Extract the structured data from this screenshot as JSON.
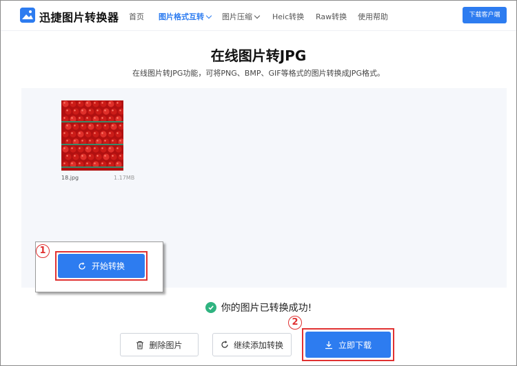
{
  "header": {
    "brand": "迅捷图片转换器",
    "nav": [
      {
        "label": "首页",
        "active": false
      },
      {
        "label": "图片格式互转",
        "active": true,
        "dropdown": true
      },
      {
        "label": "图片压缩",
        "active": false,
        "dropdown": true
      },
      {
        "label": "Heic转换",
        "active": false
      },
      {
        "label": "Raw转换",
        "active": false
      },
      {
        "label": "使用帮助",
        "active": false
      }
    ],
    "download_client": "下载客户端"
  },
  "main": {
    "title": "在线图片转JPG",
    "subtitle": "在线图片转JPG功能，可将PNG、BMP、GIF等格式的图片转换成JPG格式。"
  },
  "file": {
    "name": "18.jpg",
    "size": "1.17MB"
  },
  "annotations": {
    "step1": "1",
    "step2": "2"
  },
  "actions": {
    "start_convert": "开始转换",
    "success_message": "你的图片已转换成功!",
    "delete": "删除图片",
    "continue_add": "继续添加转换",
    "download_now": "立即下载"
  },
  "colors": {
    "primary": "#2d7cf0",
    "highlight": "#e03030",
    "success": "#2fb380"
  }
}
